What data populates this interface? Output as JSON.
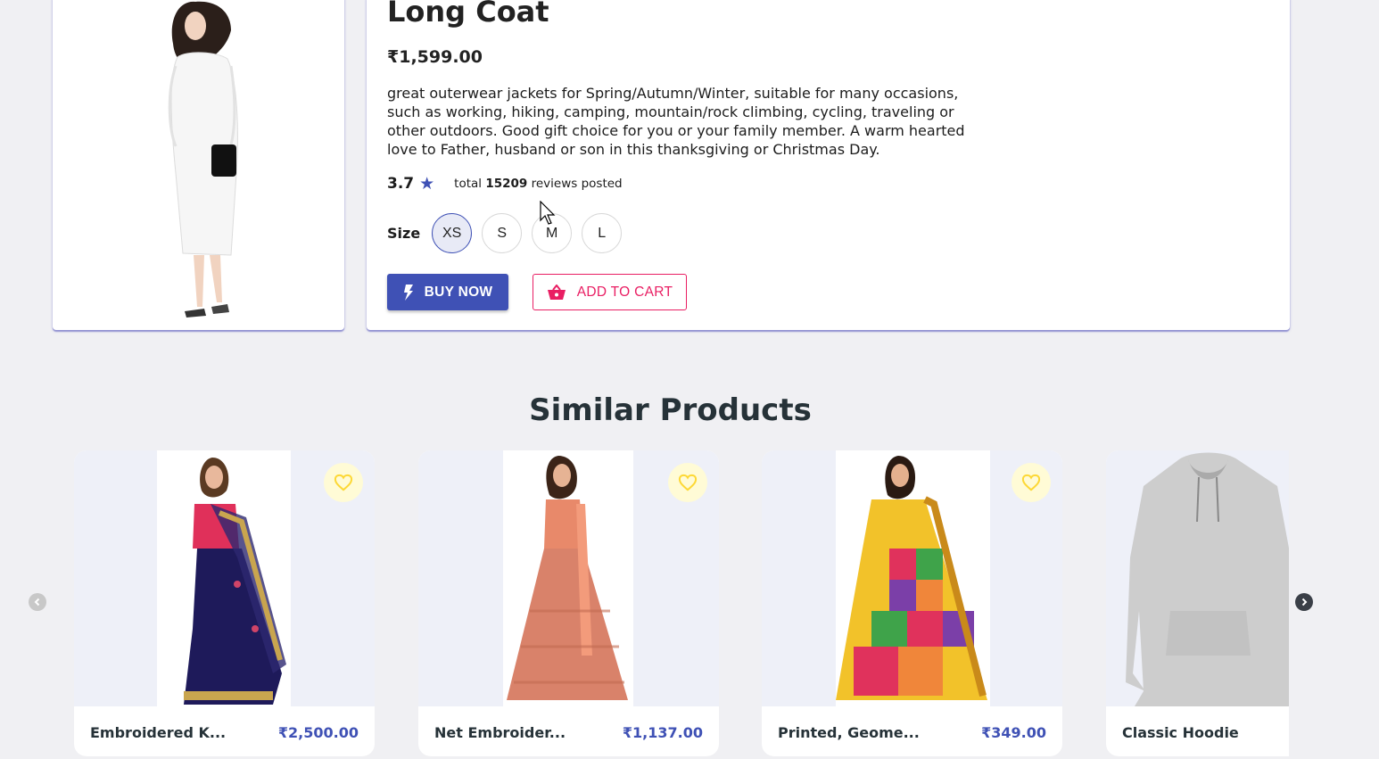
{
  "product": {
    "title": "Long Coat",
    "price": "₹1,599.00",
    "description": "great outerwear jackets for Spring/Autumn/Winter, suitable for many occasions, such as working, hiking, camping, mountain/rock climbing, cycling, traveling or other outdoors. Good gift choice for you or your family member. A warm hearted love to Father, husband or son in this thanksgiving or Christmas Day.",
    "rating": "3.7",
    "reviews_prefix": "total",
    "reviews_count": "15209",
    "reviews_suffix": "reviews posted",
    "size_label": "Size",
    "sizes": [
      "XS",
      "S",
      "M",
      "L"
    ],
    "selected_size": "XS",
    "buy_label": "BUY NOW",
    "cart_label": "ADD TO CART"
  },
  "similar": {
    "title": "Similar Products",
    "items": [
      {
        "name": "Embroidered K...",
        "price": "₹2,500.00"
      },
      {
        "name": "Net Embroider...",
        "price": "₹1,137.00"
      },
      {
        "name": "Printed, Geome...",
        "price": "₹349.00"
      },
      {
        "name": "Classic Hoodie",
        "price": ""
      }
    ]
  },
  "colors": {
    "primary": "#3f51b5",
    "accent": "#e91e63",
    "favorite": "#fdd835"
  }
}
